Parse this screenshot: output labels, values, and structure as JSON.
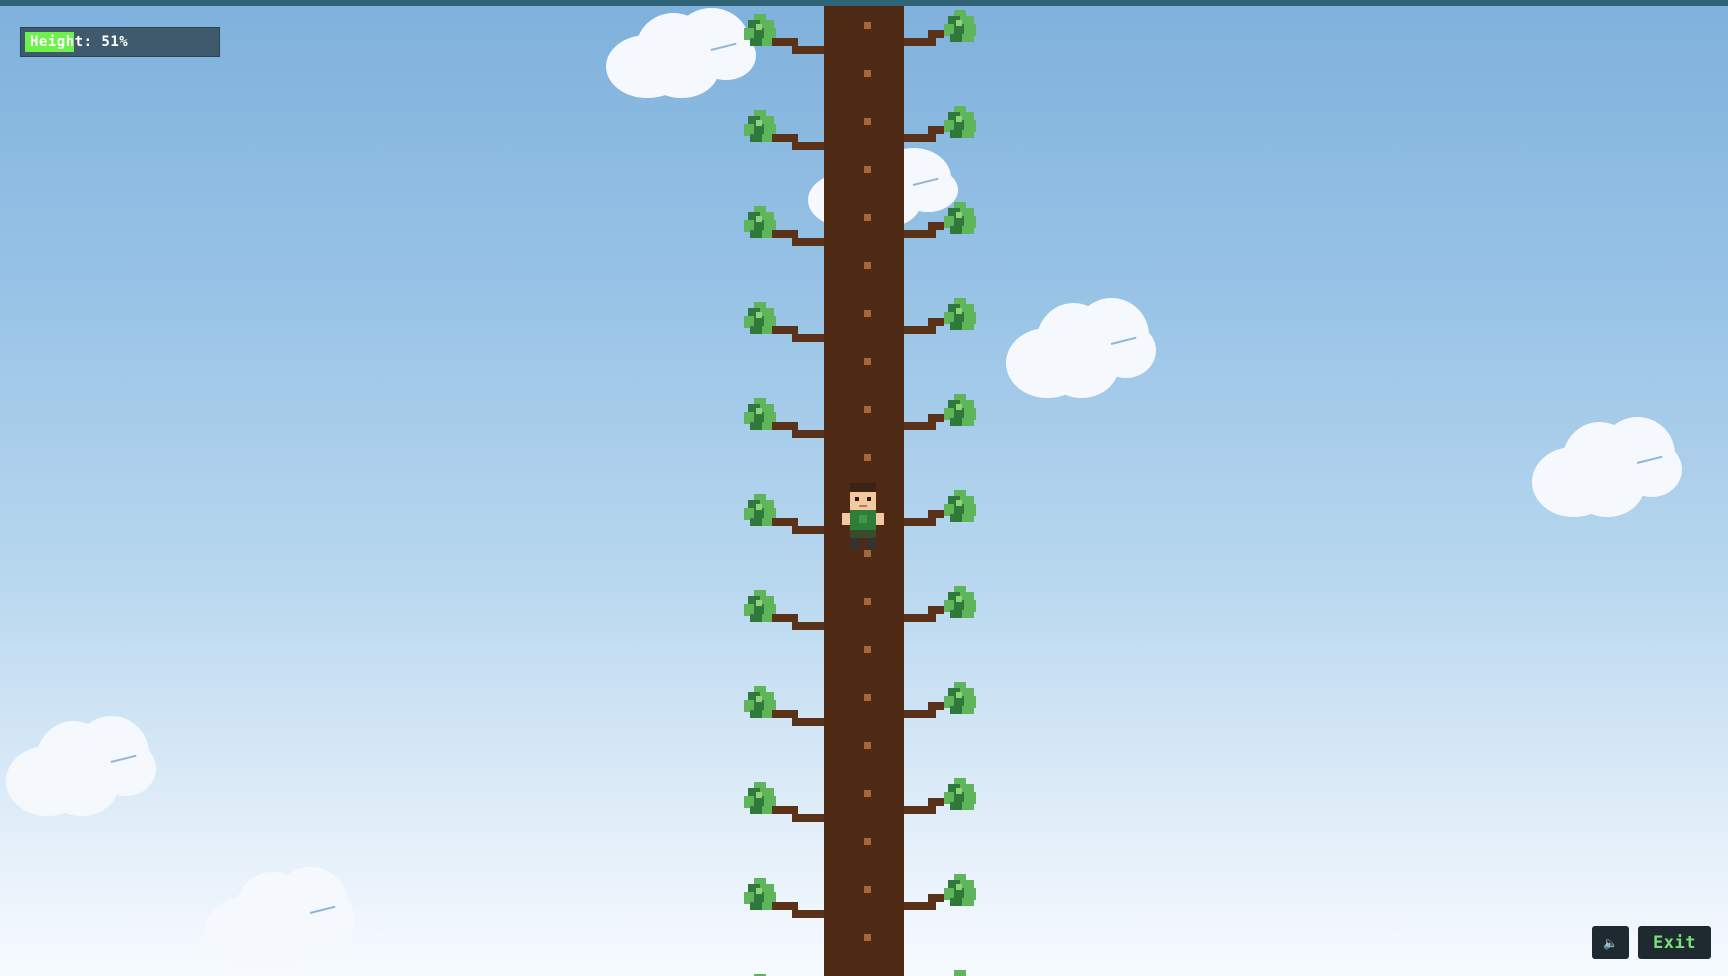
{
  "hud": {
    "height_label": "Height: 51%",
    "height_progress": 0.51
  },
  "controls": {
    "sound_icon": "speaker-icon",
    "sound_glyph": "🔈",
    "exit_label": "Exit"
  },
  "colors": {
    "sky_top": "#7fb1dc",
    "sky_bottom": "#f7fbfe",
    "trunk": "#8a4f22",
    "bark_dark": "#4e2a14",
    "branch": "#5a3219",
    "leaf_dark": "#2f7a3a",
    "leaf_light": "#5fb65a",
    "progress_fill": "#6cf24a",
    "hud_bg": "#3f5a6d",
    "exit_text": "#79e07a"
  }
}
